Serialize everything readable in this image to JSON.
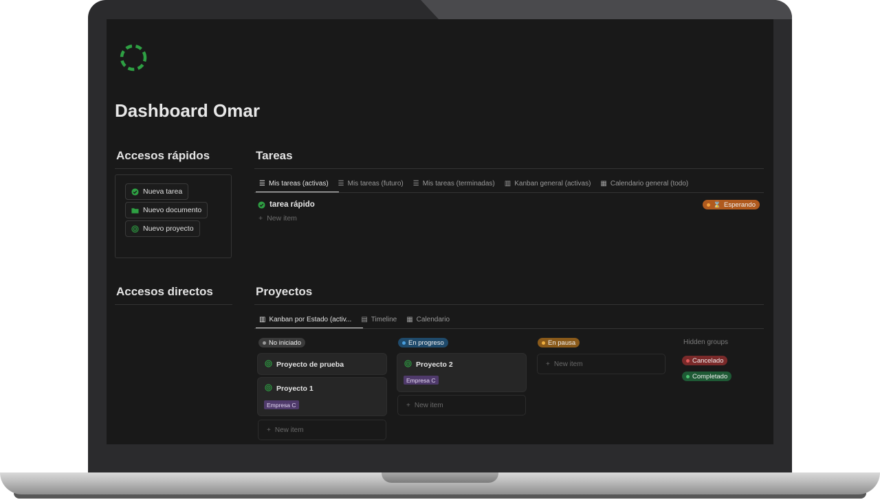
{
  "page": {
    "title": "Dashboard Omar"
  },
  "quick_access": {
    "title": "Accesos rápidos",
    "buttons": [
      {
        "label": "Nueva tarea",
        "icon": "check-circle-icon"
      },
      {
        "label": "Nuevo documento",
        "icon": "folder-icon"
      },
      {
        "label": "Nuevo proyecto",
        "icon": "target-icon"
      }
    ]
  },
  "direct_access": {
    "title": "Accesos directos"
  },
  "tasks": {
    "title": "Tareas",
    "tabs": [
      {
        "label": "Mis tareas (activas)",
        "icon": "list-icon",
        "active": true
      },
      {
        "label": "Mis tareas (futuro)",
        "icon": "list-icon",
        "active": false
      },
      {
        "label": "Mis tareas (terminadas)",
        "icon": "list-icon",
        "active": false
      },
      {
        "label": "Kanban general (activas)",
        "icon": "board-icon",
        "active": false
      },
      {
        "label": "Calendario general (todo)",
        "icon": "calendar-icon",
        "active": false
      }
    ],
    "rows": [
      {
        "title": "tarea rápido",
        "status": "Esperando",
        "status_icon": "hourglass-icon"
      }
    ],
    "new_item": "New item"
  },
  "projects": {
    "title": "Proyectos",
    "tabs": [
      {
        "label": "Kanban por Estado (activ...",
        "icon": "board-icon",
        "active": true
      },
      {
        "label": "Timeline",
        "icon": "timeline-icon",
        "active": false
      },
      {
        "label": "Calendario",
        "icon": "calendar-icon",
        "active": false
      }
    ],
    "columns": [
      {
        "status": "No iniciado",
        "cards": [
          {
            "title": "Proyecto de prueba",
            "tag": ""
          },
          {
            "title": "Proyecto 1",
            "tag": "Empresa C"
          }
        ],
        "new_item": "New item"
      },
      {
        "status": "En progreso",
        "cards": [
          {
            "title": "Proyecto 2",
            "tag": "Empresa C"
          }
        ],
        "new_item": "New item"
      },
      {
        "status": "En pausa",
        "cards": [],
        "new_item": "New item"
      }
    ],
    "hidden_groups": {
      "label": "Hidden groups",
      "items": [
        "Cancelado",
        "Completado"
      ]
    }
  },
  "colors": {
    "screen_bg": "#191919",
    "accent_green": "#2ea043",
    "status_waiting": "#b05a1e",
    "status_not_started": "#3a3a3a",
    "status_in_progress": "#1f4a6b",
    "status_paused": "#8a5a1a",
    "status_cancelled": "#7a2a2a",
    "status_completed": "#1e5a35",
    "tag_purple": "#4f3a6b"
  }
}
